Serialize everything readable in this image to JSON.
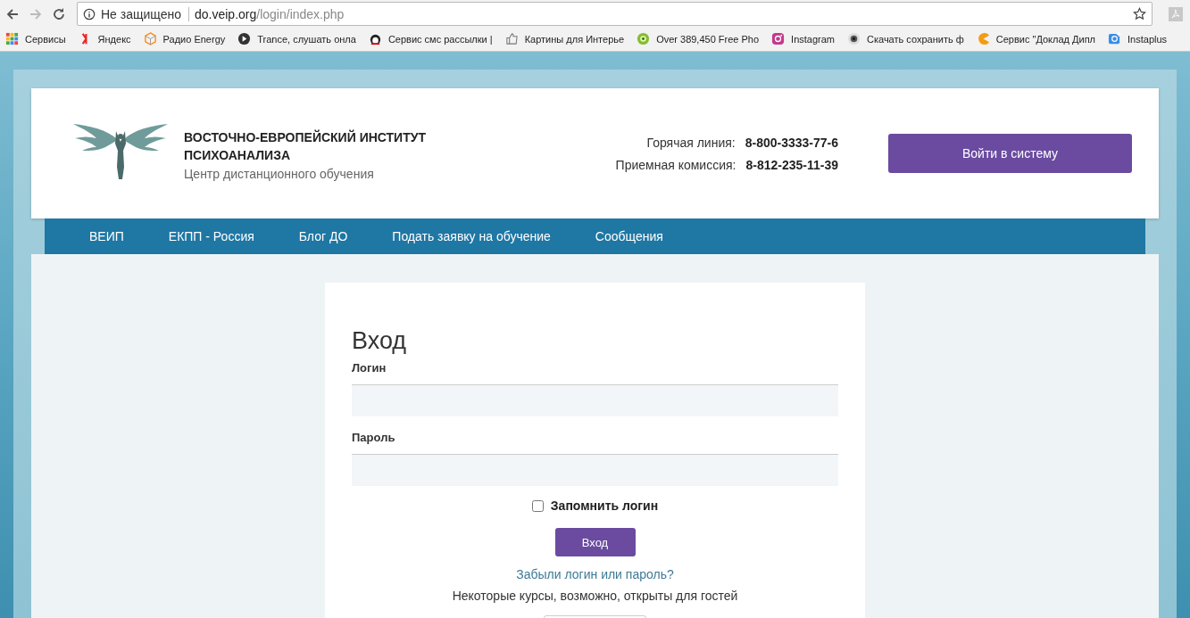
{
  "browser": {
    "security_label": "Не защищено",
    "url_host": "do.veip.org",
    "url_path": "/login/index.php",
    "bookmarks": [
      "Сервисы",
      "Яндекс",
      "Радио Energy",
      "Trance, слушать онла",
      "Сервис смс рассылки |",
      "Картины для Интерье",
      "Over 389,450 Free Pho",
      "Instagram",
      "Скачать сохранить ф",
      "Сервис \"Доклад Дипл",
      "Instaplus"
    ]
  },
  "header": {
    "title_line1": "ВОСТОЧНО-ЕВРОПЕЙСКИЙ ИНСТИТУТ",
    "title_line2": "ПСИХОАНАЛИЗА",
    "subtitle": "Центр дистанционного обучения",
    "contacts": [
      {
        "label": "Горячая линия:",
        "value": "8-800-3333-77-6"
      },
      {
        "label": "Приемная комиссия:",
        "value": "8-812-235-11-39"
      }
    ],
    "login_button": "Войти в систему"
  },
  "nav": [
    "ВЕИП",
    "ЕКПП - Россия",
    "Блог ДО",
    "Подать заявку на обучение",
    "Сообщения"
  ],
  "login": {
    "heading": "Вход",
    "username_label": "Логин",
    "password_label": "Пароль",
    "remember": {
      "label": "Запомнить логин",
      "checked": false
    },
    "submit": "Вход",
    "forgot_link": "Забыли логин или пароль?",
    "guest_note": "Некоторые курсы, возможно, открыты для гостей"
  }
}
